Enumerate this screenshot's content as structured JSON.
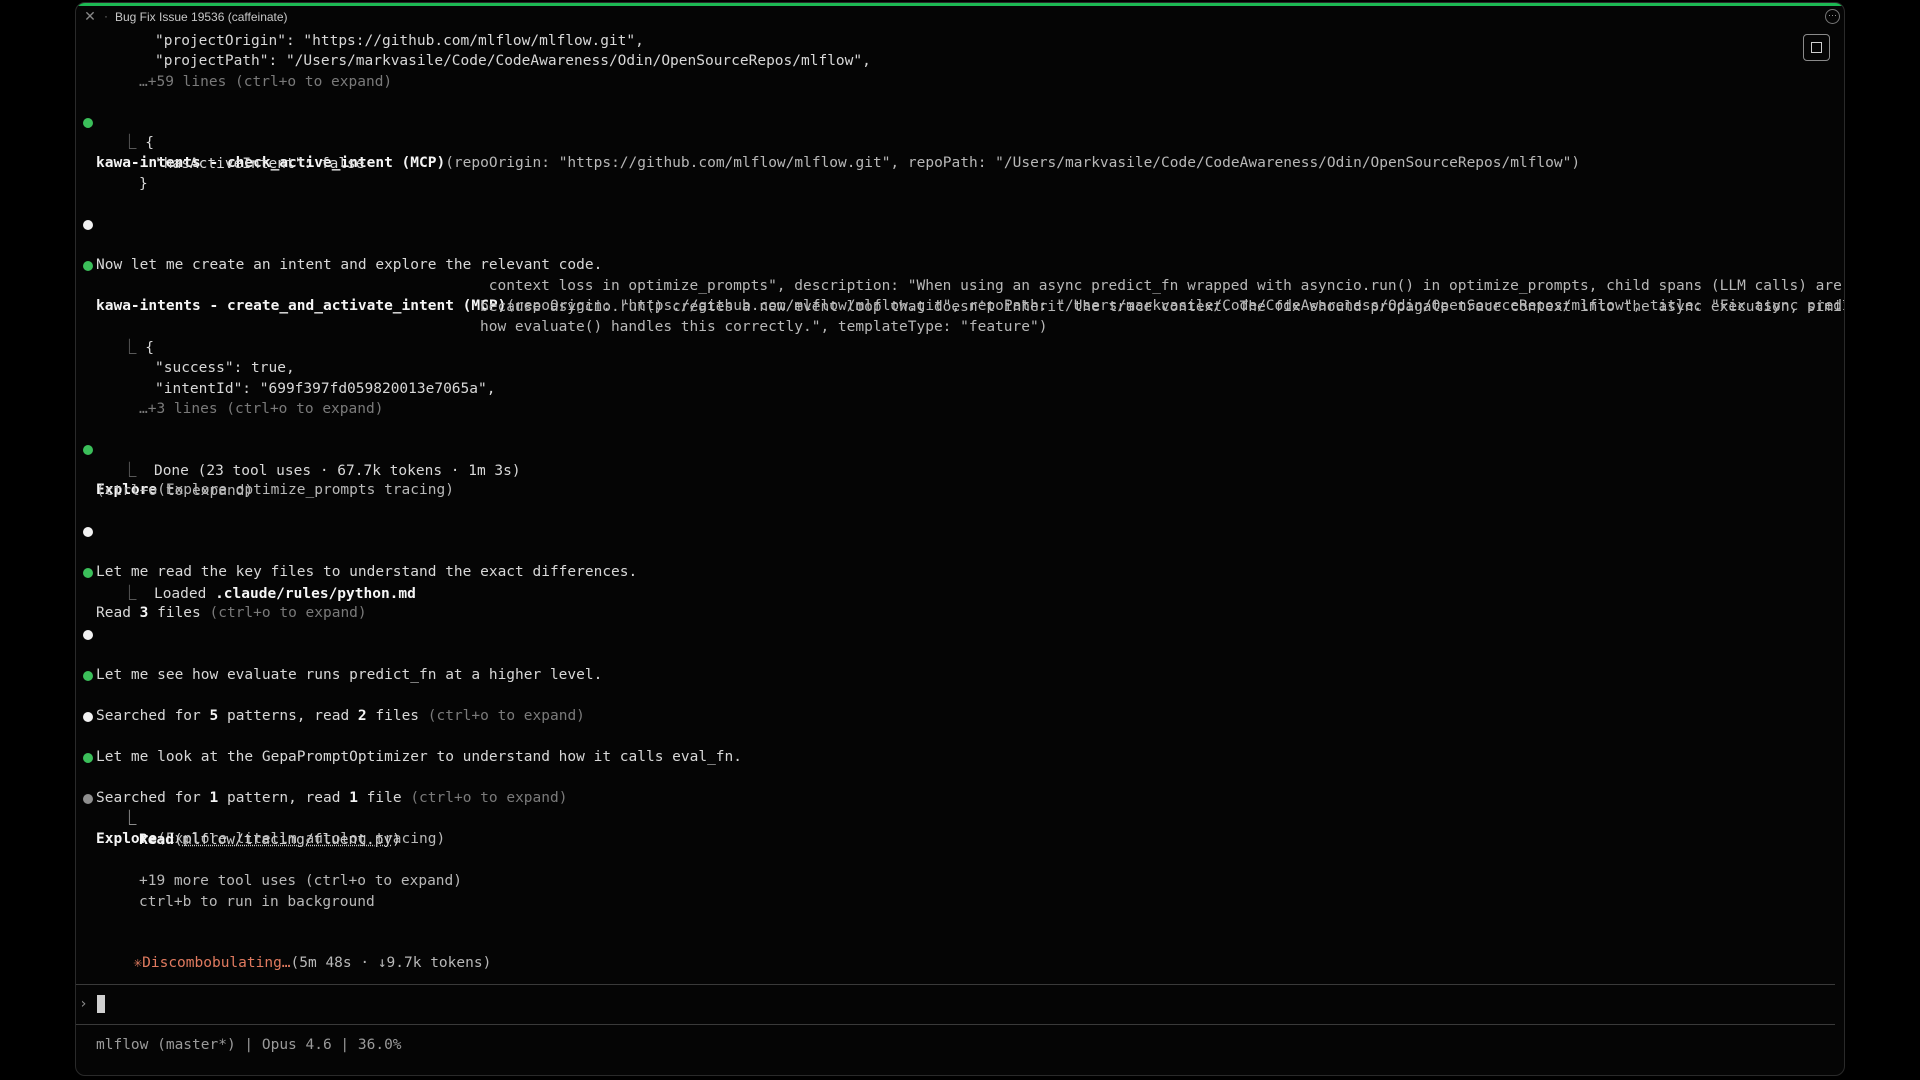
{
  "window": {
    "title": "Bug Fix Issue 19536 (caffeinate)",
    "dot": "·",
    "accent_color": "#1db954"
  },
  "lines": {
    "l1": "\"projectOrigin\": \"https://github.com/mlflow/mlflow.git\",",
    "l2": "\"projectPath\": \"/Users/markvasile/Code/CodeAwareness/Odin/OpenSourceRepos/mlflow\",",
    "l3": "…+59 lines (ctrl+o to expand)",
    "l4_name": "kawa-intents - check_active_intent (MCP)",
    "l4_args": "(repoOrigin: \"https://github.com/mlflow/mlflow.git\", repoPath: \"/Users/markvasile/Code/CodeAwareness/Odin/OpenSourceRepos/mlflow\")",
    "l5": "{",
    "l6": "\"hasActiveIntent\": false",
    "l7": "}",
    "l8": "Now let me create an intent and explore the relevant code.",
    "l9_name": "kawa-intents - create_and_activate_intent (MCP)",
    "l9_args": "(repoOrigin: \"https://github.com/mlflow/mlflow.git\", repoPath: \"/Users/markvasile/Code/CodeAwareness/Odin/OpenSourceRepos/mlflow\", title: \"Fix async predict_fn trace",
    "l10": " context loss in optimize_prompts\", description: \"When using an async predict_fn wrapped with asyncio.run() in optimize_prompts, child spans (LLM calls) are lost",
    "l11": "because asyncio.run() creates a new event loop that doesn't inherit the trace context. The fix should propagate trace context into the async execution, similar to",
    "l12": "how evaluate() handles this correctly.\", templateType: \"feature\")",
    "l13": "{",
    "l14": "\"success\": true,",
    "l15": "\"intentId\": \"699f397fd059820013e7065a\",",
    "l16": "…+3 lines (ctrl+o to expand)",
    "l17_name": "Explore",
    "l17_args": "(Explore optimize_prompts tracing)",
    "l18": "Done (23 tool uses · 67.7k tokens · 1m 3s)",
    "l19": "(ctrl+o to expand)",
    "l20": "Let me read the key files to understand the exact differences.",
    "l21_a": "Read ",
    "l21_b": "3",
    "l21_c": " files ",
    "l21_d": "(ctrl+o to expand)",
    "l22_a": "Loaded ",
    "l22_b": ".claude/rules/python.md",
    "l23": "Let me see how evaluate runs predict_fn at a higher level.",
    "l24_a": "Searched for ",
    "l24_b": "5",
    "l24_c": " patterns, read ",
    "l24_d": "2",
    "l24_e": " files ",
    "l24_f": "(ctrl+o to expand)",
    "l25": "Let me look at the GepaPromptOptimizer to understand how it calls eval_fn.",
    "l26_a": "Searched for ",
    "l26_b": "1",
    "l26_c": " pattern, read ",
    "l26_d": "1",
    "l26_e": " file ",
    "l26_f": "(ctrl+o to expand)",
    "l27_name": "Explore",
    "l27_args": "(Explore litellm autolog tracing)",
    "l29_name": "Read",
    "l29_paren_open": "(",
    "l29_path": "mlflow/tracing/fluent.py",
    "l29_paren_close": ")",
    "l30": "+19 more tool uses (ctrl+o to expand)",
    "l31": "ctrl+b to run in background",
    "l32_star": "✳",
    "l32_status": "Discombobulating…",
    "l32_meta": "(5m 48s · ↓9.7k tokens)",
    "elbow": "⎿"
  },
  "prompt": {
    "caret": "›"
  },
  "statusbar": {
    "text": "mlflow (master*) | Opus 4.6 | 36.0%"
  }
}
